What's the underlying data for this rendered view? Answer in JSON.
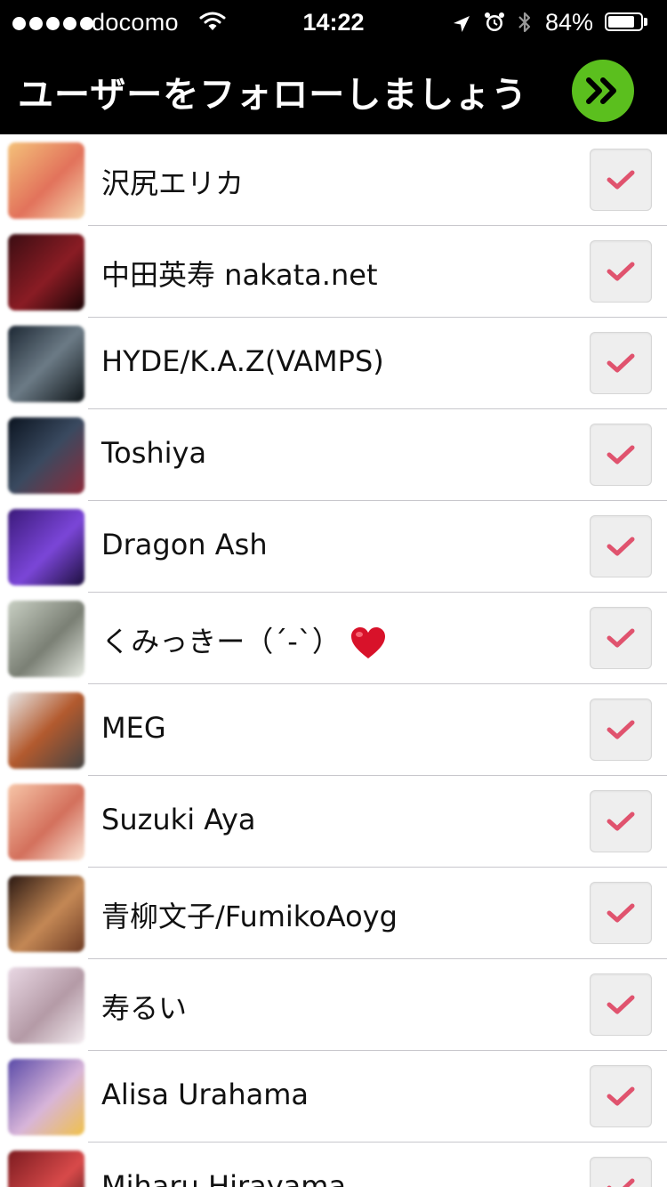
{
  "status_bar": {
    "carrier": "docomo",
    "time": "14:22",
    "battery_percent": "84%",
    "battery_level": 0.84,
    "icons": [
      "signal-dots-icon",
      "wifi-icon",
      "location-arrow-icon",
      "alarm-icon",
      "bluetooth-icon",
      "battery-icon"
    ]
  },
  "header": {
    "title": "ユーザーをフォローしましょう",
    "next_icon": "double-chevron-right-icon",
    "next_color": "#5bbf1e"
  },
  "colors": {
    "check": "#e0536e",
    "header_bg": "#000000"
  },
  "users": [
    {
      "name": "沢尻エリカ",
      "checked": true
    },
    {
      "name": "中田英寿 nakata.net",
      "checked": true
    },
    {
      "name": "HYDE/K.A.Z(VAMPS)",
      "checked": true
    },
    {
      "name": "Toshiya",
      "checked": true
    },
    {
      "name": "Dragon Ash",
      "checked": true
    },
    {
      "name": "くみっきー（´-`）",
      "checked": true,
      "emoji": "heart-icon"
    },
    {
      "name": "MEG",
      "checked": true
    },
    {
      "name": "Suzuki Aya",
      "checked": true
    },
    {
      "name": "青柳文子/FumikoAoyg",
      "checked": true
    },
    {
      "name": "寿るい",
      "checked": true
    },
    {
      "name": "Alisa Urahama",
      "checked": true
    },
    {
      "name": "Miharu Hirayama",
      "checked": true
    }
  ]
}
